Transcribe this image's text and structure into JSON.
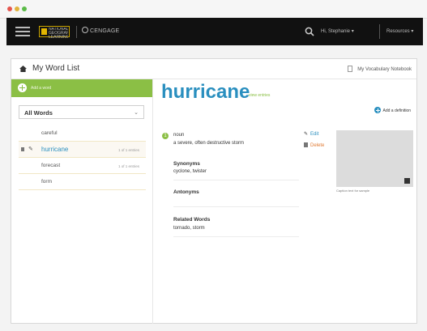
{
  "topbar": {
    "logo_text": "NATIONAL GEOGRAPHIC LEARNING",
    "partner": "CENGAGE",
    "user": "Hi, Stephanie",
    "resources": "Resources"
  },
  "header": {
    "title": "My Word List",
    "notebook_link": "My Vocabulary Notebook"
  },
  "sidebar": {
    "add_word_label": "Add a word",
    "filter_value": "All Words",
    "words": [
      {
        "label": "careful",
        "meta": ""
      },
      {
        "label": "hurricane",
        "meta": "1 of 1 entries"
      },
      {
        "label": "forecast",
        "meta": "1 of 1 entries"
      },
      {
        "label": "form",
        "meta": ""
      }
    ]
  },
  "entry": {
    "headword": "hurricane",
    "view_entry": "view entries",
    "add_definition": "Add a definition",
    "definition_number": "1",
    "part_of_speech": "noun",
    "definition": "a severe, often destructive storm",
    "edit_label": "Edit",
    "delete_label": "Delete",
    "synonyms_label": "Synonyms",
    "synonyms_value": "cyclone, twister",
    "antonyms_label": "Antonyms",
    "related_label": "Related Words",
    "related_value": "tornado, storm",
    "image_caption": "Caption text for sample"
  },
  "colors": {
    "accent_green": "#8bbf45",
    "accent_blue": "#2a8fbf",
    "delete_orange": "#e07b35"
  }
}
